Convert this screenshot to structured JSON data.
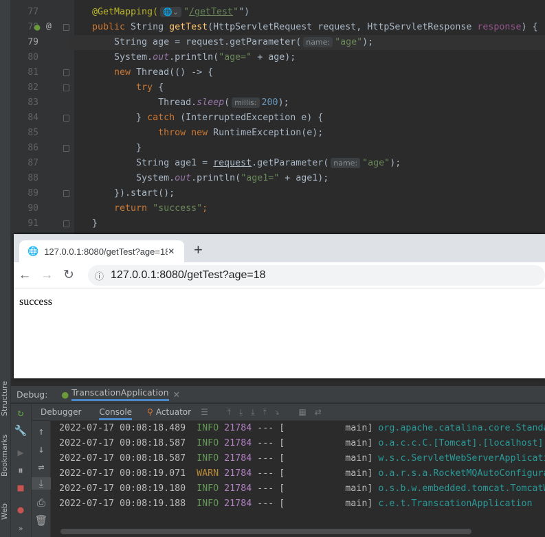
{
  "editor": {
    "line_numbers": [
      "77",
      "78",
      "79",
      "80",
      "81",
      "82",
      "83",
      "84",
      "85",
      "86",
      "87",
      "88",
      "89",
      "90",
      "91"
    ],
    "current_line": "79",
    "lines": [
      [
        [
          "a",
          "@GetMapping("
        ],
        [
          "h",
          "🌐⌄"
        ],
        [
          "s",
          "\""
        ],
        [
          "s u",
          "/getTest"
        ],
        [
          "s",
          "\""
        ],
        [
          "",
          "\")"
        ]
      ],
      [
        [
          "k",
          "public "
        ],
        [
          "",
          "String "
        ],
        [
          "m",
          "getTest"
        ],
        [
          "",
          "(HttpServletRequest request, HttpServletResponse "
        ],
        [
          "p",
          "response"
        ],
        [
          "",
          ") {"
        ]
      ],
      [
        [
          "",
          "    String age = request.getParameter("
        ],
        [
          "h",
          "name:"
        ],
        [
          "s",
          "\"age\""
        ],
        [
          "",
          ");"
        ]
      ],
      [
        [
          "",
          "    System."
        ],
        [
          "f",
          "out"
        ],
        [
          "",
          ".println("
        ],
        [
          "s",
          "\"age=\""
        ],
        [
          "",
          " + age);"
        ]
      ],
      [
        [
          "k",
          "    new "
        ],
        [
          "",
          "Thread(() -> {"
        ]
      ],
      [
        [
          "k",
          "        try "
        ],
        [
          "",
          "{"
        ]
      ],
      [
        [
          "",
          "            Thread."
        ],
        [
          "f",
          "sleep"
        ],
        [
          "",
          "("
        ],
        [
          "h",
          "millis:"
        ],
        [
          "n",
          "200"
        ],
        [
          "",
          ");"
        ]
      ],
      [
        [
          "",
          "        } "
        ],
        [
          "k",
          "catch "
        ],
        [
          "",
          "(InterruptedException e) {"
        ]
      ],
      [
        [
          "k",
          "            throw new "
        ],
        [
          "",
          "RuntimeException(e);"
        ]
      ],
      [
        [
          "",
          "        }"
        ]
      ],
      [
        [
          "",
          "        String age1 = "
        ],
        [
          "u",
          "request"
        ],
        [
          "",
          ".getParameter("
        ],
        [
          "h",
          "name:"
        ],
        [
          "s",
          "\"age\""
        ],
        [
          "",
          ");"
        ]
      ],
      [
        [
          "",
          "        System."
        ],
        [
          "f",
          "out"
        ],
        [
          "",
          ".println("
        ],
        [
          "s",
          "\"age1=\""
        ],
        [
          "",
          " + age1);"
        ]
      ],
      [
        [
          "",
          "    }).start();"
        ]
      ],
      [
        [
          "k",
          "    return "
        ],
        [
          "s",
          "\"success\""
        ],
        [
          "k",
          ";"
        ]
      ],
      [
        [
          "",
          "}"
        ]
      ]
    ]
  },
  "browser": {
    "tab_title": "127.0.0.1:8080/getTest?age=18",
    "url": "127.0.0.1:8080/getTest?age=18",
    "body_text": "success",
    "new_tab": "+",
    "close": "✕"
  },
  "debug": {
    "label": "Debug:",
    "config": "TranscationApplication",
    "tabs": [
      "Debugger",
      "Console",
      "Actuator"
    ],
    "active_tab": "Console"
  },
  "side_tools": [
    "Structure",
    "Bookmarks",
    "Web"
  ],
  "console": [
    {
      "time": "2022-07-17 00:08:18.489",
      "level": "INFO",
      "pid": "21784",
      "thread": "main",
      "logger": "org.apache.catalina.core.Standa"
    },
    {
      "time": "2022-07-17 00:08:18.587",
      "level": "INFO",
      "pid": "21784",
      "thread": "main",
      "logger": "o.a.c.c.C.[Tomcat].[localhost]"
    },
    {
      "time": "2022-07-17 00:08:18.587",
      "level": "INFO",
      "pid": "21784",
      "thread": "main",
      "logger": "w.s.c.ServletWebServerApplicati"
    },
    {
      "time": "2022-07-17 00:08:19.071",
      "level": "WARN",
      "pid": "21784",
      "thread": "main",
      "logger": "o.a.r.s.a.RocketMQAutoConfigura"
    },
    {
      "time": "2022-07-17 00:08:19.180",
      "level": "INFO",
      "pid": "21784",
      "thread": "main",
      "logger": "o.s.b.w.embedded.tomcat.TomcatW"
    },
    {
      "time": "2022-07-17 00:08:19.188",
      "level": "INFO",
      "pid": "21784",
      "thread": "main",
      "logger": "c.e.t.TranscationApplication"
    }
  ]
}
